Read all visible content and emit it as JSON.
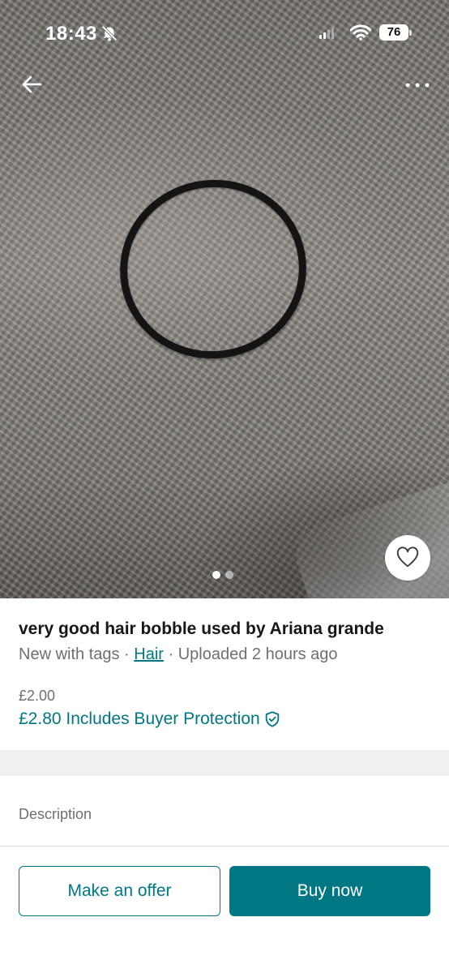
{
  "status_bar": {
    "time": "18:43",
    "battery": "76"
  },
  "colors": {
    "accent": "#007782",
    "text_primary": "#171717",
    "text_secondary": "#6f6f6f",
    "band": "#eff1f2"
  },
  "icons": {
    "status": [
      "bell-off-icon",
      "signal-icon",
      "wifi-icon",
      "battery-icon"
    ],
    "toolbar": [
      "arrow-left-icon",
      "more-horizontal-icon"
    ],
    "photo": [
      "heart-icon"
    ],
    "pricing": [
      "shield-check-icon"
    ]
  },
  "gallery": {
    "photo_count": 2,
    "active_index": 0
  },
  "item": {
    "title": "very good hair bobble used by Ariana grande",
    "condition": "New with tags",
    "separator": " · ",
    "category": "Hair",
    "uploaded": "Uploaded 2 hours ago",
    "price": "£2.00",
    "buyer_protection_price": "£2.80 Includes Buyer Protection"
  },
  "description": {
    "label": "Description"
  },
  "actions": {
    "offer_label": "Make an offer",
    "buy_label": "Buy now"
  }
}
